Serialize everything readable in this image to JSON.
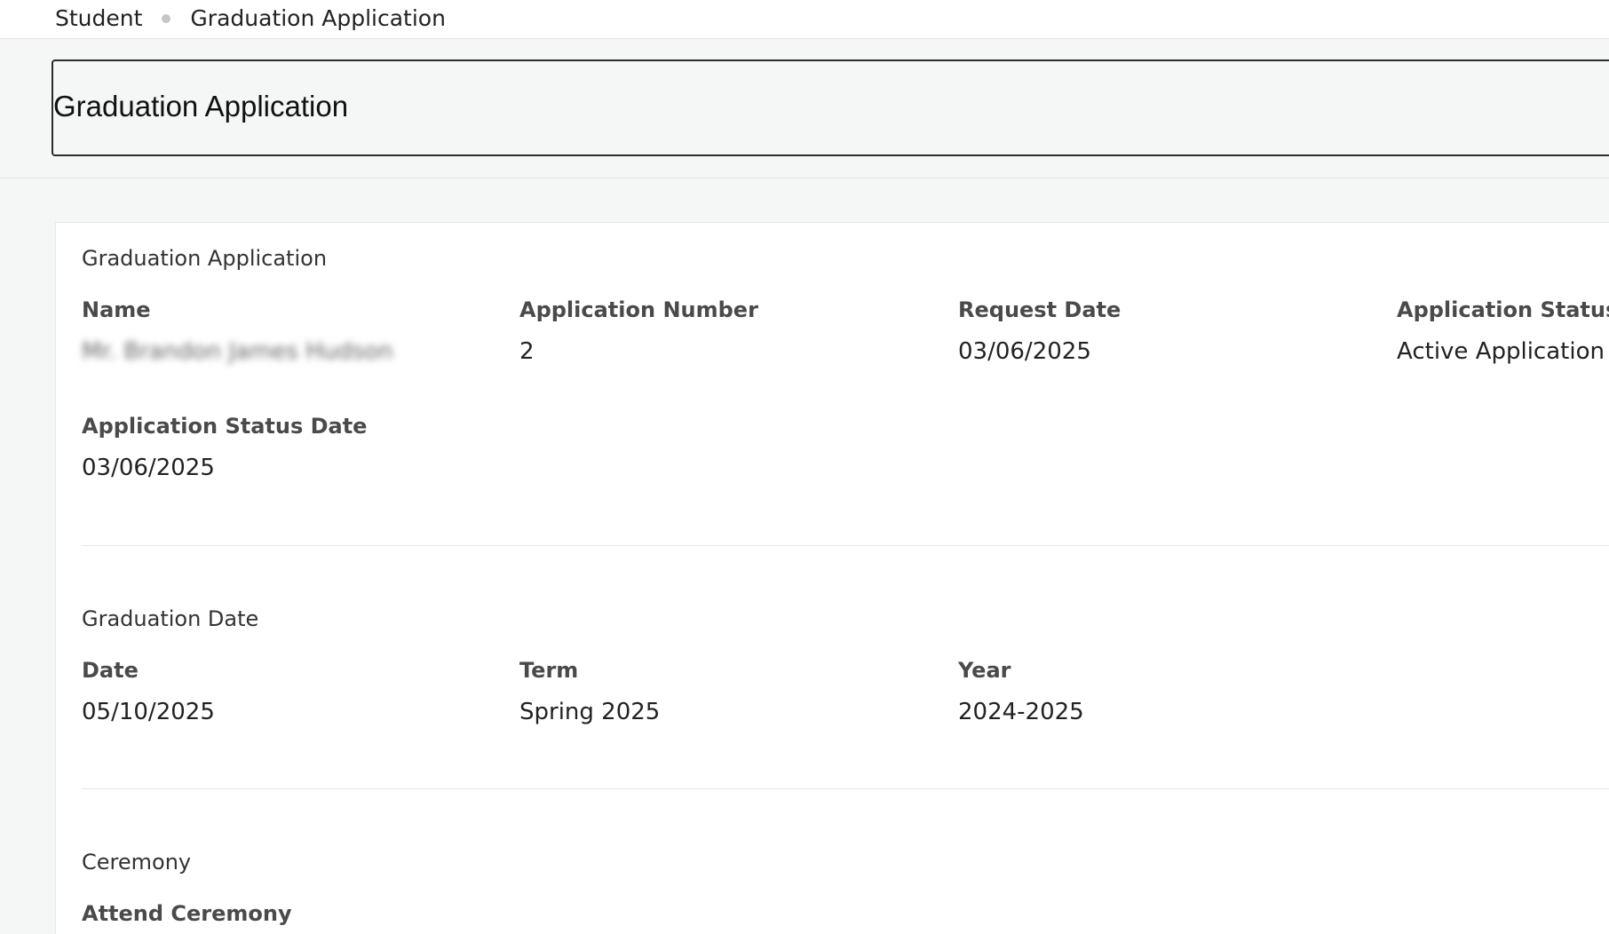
{
  "breadcrumb": {
    "items": [
      "Student",
      "Graduation Application"
    ]
  },
  "page": {
    "title": "Graduation Application"
  },
  "application": {
    "section_title": "Graduation Application",
    "name_label": "Name",
    "name_value": "Mr. Brandon James Hudson",
    "number_label": "Application Number",
    "number_value": "2",
    "request_date_label": "Request Date",
    "request_date_value": "03/06/2025",
    "status_label": "Application Status",
    "status_value": "Active Application",
    "status_date_label": "Application Status Date",
    "status_date_value": "03/06/2025"
  },
  "graduation_date": {
    "section_title": "Graduation Date",
    "date_label": "Date",
    "date_value": "05/10/2025",
    "term_label": "Term",
    "term_value": "Spring 2025",
    "year_label": "Year",
    "year_value": "2024-2025"
  },
  "ceremony": {
    "section_title": "Ceremony",
    "attend_label": "Attend Ceremony"
  }
}
